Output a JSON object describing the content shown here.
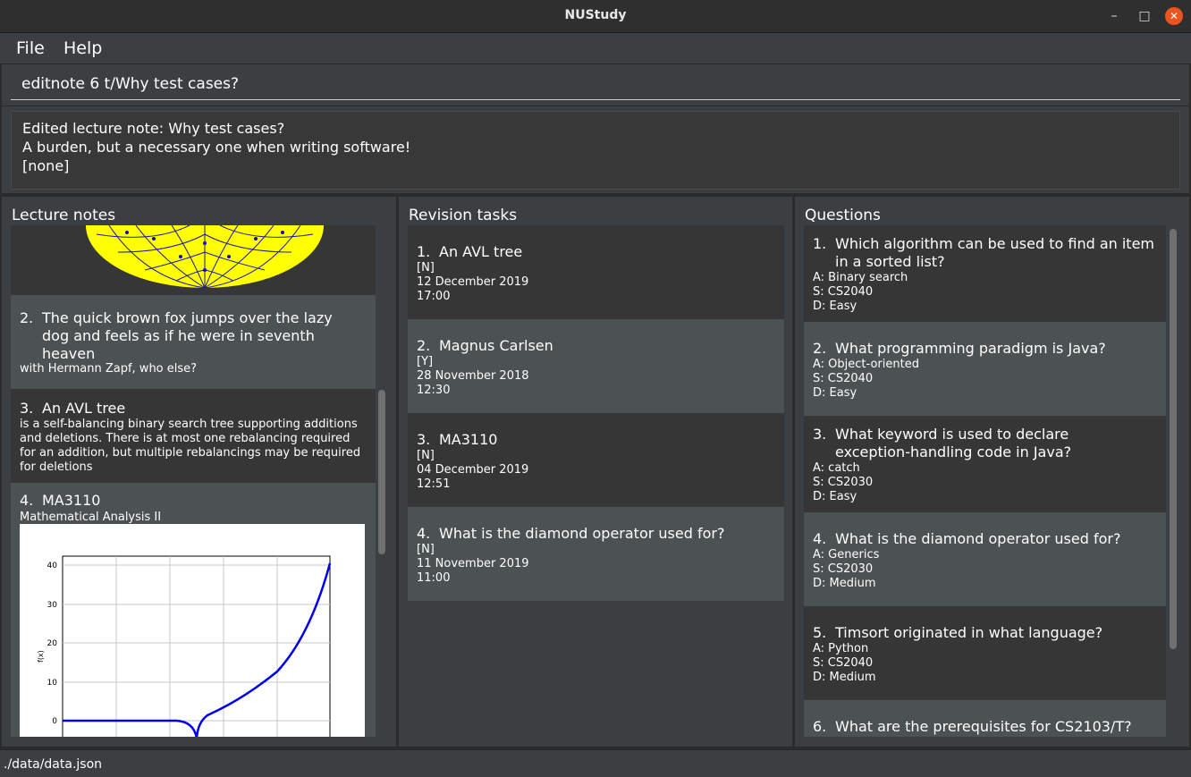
{
  "window": {
    "title": "NUStudy"
  },
  "menu": {
    "file": "File",
    "help": "Help"
  },
  "command": {
    "value": "editnote 6 t/Why test cases?"
  },
  "result": {
    "text": "Edited lecture note: Why test cases?\nA burden, but a necessary one when writing software!\n[none]"
  },
  "lecture_notes": {
    "title": "Lecture notes",
    "items": [
      {
        "index": "2.",
        "title": "The quick brown fox jumps over the lazy dog and feels as if he were in seventh heaven",
        "content": "with Hermann Zapf, who else?"
      },
      {
        "index": "3.",
        "title": "An AVL tree",
        "content": "is a self-balancing binary search tree supporting additions and deletions. There is at most one rebalancing required for an addition, but multiple rebalancings may be required for deletions"
      },
      {
        "index": "4.",
        "title": "MA3110",
        "content": "Mathematical Analysis II"
      }
    ],
    "plot": {
      "ylabel": "f(x)",
      "yticks": [
        "40",
        "30",
        "20",
        "10",
        "0"
      ]
    }
  },
  "revision_tasks": {
    "title": "Revision tasks",
    "items": [
      {
        "index": "1.",
        "title": "An AVL tree",
        "status": "[N]",
        "date": "12 December 2019",
        "time": "17:00"
      },
      {
        "index": "2.",
        "title": "Magnus Carlsen",
        "status": "[Y]",
        "date": "28 November 2018",
        "time": "12:30"
      },
      {
        "index": "3.",
        "title": "MA3110",
        "status": "[N]",
        "date": "04 December 2019",
        "time": "12:51"
      },
      {
        "index": "4.",
        "title": "What is the diamond operator used for?",
        "status": "[N]",
        "date": "11 November 2019",
        "time": "11:00"
      }
    ]
  },
  "questions": {
    "title": "Questions",
    "items": [
      {
        "index": "1.",
        "title": "Which algorithm can be used to find an item in a sorted list?",
        "answer": "A: Binary search",
        "subject": "S: CS2040",
        "difficulty": "D: Easy"
      },
      {
        "index": "2.",
        "title": "What programming paradigm is Java?",
        "answer": "A: Object-oriented",
        "subject": "S: CS2040",
        "difficulty": "D: Easy"
      },
      {
        "index": "3.",
        "title": "What keyword is used to declare exception-handling code in Java?",
        "answer": "A: catch",
        "subject": "S: CS2030",
        "difficulty": "D: Easy"
      },
      {
        "index": "4.",
        "title": "What is the diamond operator used for?",
        "answer": "A: Generics",
        "subject": "S: CS2030",
        "difficulty": "D: Medium"
      },
      {
        "index": "5.",
        "title": "Timsort originated in what language?",
        "answer": "A: Python",
        "subject": "S: CS2040",
        "difficulty": "D: Medium"
      },
      {
        "index": "6.",
        "title": "What are the prerequisites for CS2103/T?",
        "answer": "",
        "subject": "",
        "difficulty": ""
      }
    ]
  },
  "status": {
    "path": "./data/data.json"
  },
  "colors": {
    "accent_close": "#e95420",
    "plot_line": "#0000ee",
    "fractal": "#ffff00"
  }
}
